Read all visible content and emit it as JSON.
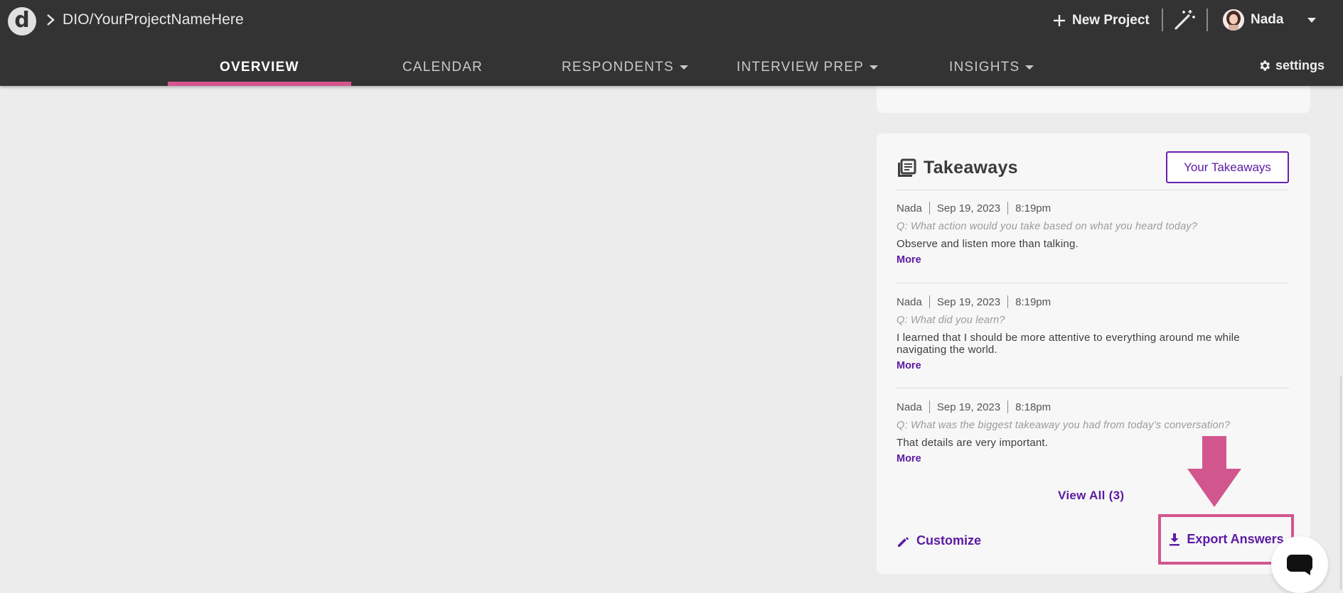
{
  "header": {
    "breadcrumb_path": "DIO/YourProjectNameHere",
    "new_project_label": "New Project",
    "user_name": "Nada"
  },
  "nav": {
    "tabs": [
      {
        "label": "OVERVIEW",
        "active": true
      },
      {
        "label": "CALENDAR",
        "active": false
      },
      {
        "label": "RESPONDENTS",
        "active": false,
        "has_dropdown": true
      },
      {
        "label": "INTERVIEW PREP",
        "active": false,
        "has_dropdown": true
      },
      {
        "label": "INSIGHTS",
        "active": false,
        "has_dropdown": true
      }
    ],
    "settings_label": "settings"
  },
  "takeaways": {
    "title": "Takeaways",
    "your_takeaways_button": "Your Takeaways",
    "entries": [
      {
        "author": "Nada",
        "date": "Sep 19, 2023",
        "time": "8:19pm",
        "question": "Q: What action would you take based on what you heard today?",
        "answer": "Observe and listen more than talking.",
        "more_label": "More"
      },
      {
        "author": "Nada",
        "date": "Sep 19, 2023",
        "time": "8:19pm",
        "question": "Q: What did you learn?",
        "answer": "I learned that I should be more attentive to everything around me while navigating the world.",
        "more_label": "More"
      },
      {
        "author": "Nada",
        "date": "Sep 19, 2023",
        "time": "8:18pm",
        "question": "Q: What was the biggest takeaway you had from today’s conversation?",
        "answer": "That details are very important.",
        "more_label": "More"
      }
    ],
    "view_all_label": "View All (3)",
    "customize_label": "Customize",
    "export_label": "Export Answers"
  },
  "colors": {
    "header_bg": "#333333",
    "page_bg": "#ececec",
    "accent_pink": "#d6558f",
    "link_purple": "#5b1aa3",
    "card_bg": "#f7f7f7"
  },
  "icons": {
    "logo": "dscout-logo-icon",
    "breadcrumb": "chevron-right-icon",
    "new_project": "plus-icon",
    "magic": "magic-wand-icon",
    "user_menu": "caret-down-icon",
    "settings": "gear-icon",
    "takeaways": "library-books-icon",
    "customize": "pencil-icon",
    "export": "download-icon",
    "annotation": "arrow-down-icon",
    "chat": "chat-icon"
  }
}
